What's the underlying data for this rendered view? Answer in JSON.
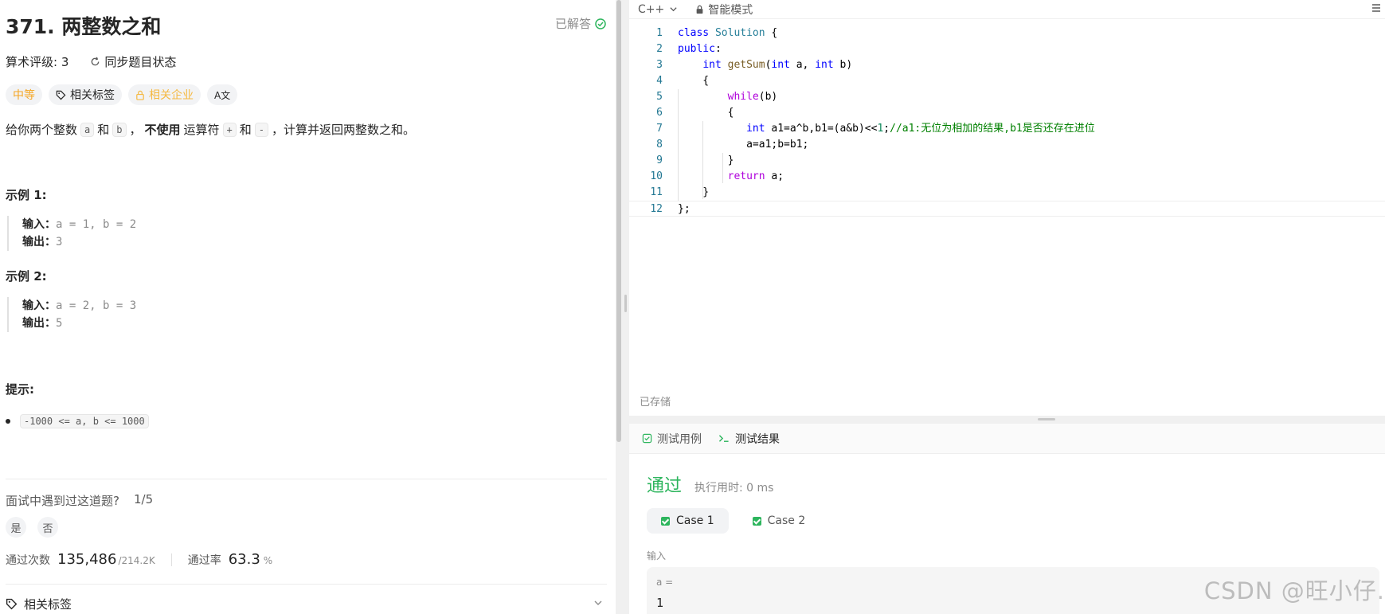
{
  "problem": {
    "title": "371. 两整数之和",
    "solved": "已解答",
    "rating": "算术评级: 3",
    "sync": "同步题目状态",
    "tags": {
      "difficulty": "中等",
      "related": "相关标签",
      "companies": "相关企业",
      "translate": "A文"
    },
    "desc": {
      "p1": "给你两个整数",
      "a": "a",
      "and1": "和",
      "b": "b",
      "p2": "，",
      "bold": "不使用",
      "p3": "运算符",
      "plus": "+",
      "and2": "和",
      "minus": "-",
      "p4": "，计算并返回两整数之和。"
    },
    "ex1": {
      "title": "示例 1:",
      "in_label": "输入：",
      "in": "a = 1, b = 2",
      "out_label": "输出：",
      "out": "3"
    },
    "ex2": {
      "title": "示例 2:",
      "in_label": "输入：",
      "in": "a = 2, b = 3",
      "out_label": "输出：",
      "out": "5"
    },
    "hint_title": "提示:",
    "hint": "-1000 <= a, b <= 1000",
    "interview": {
      "q": "面试中遇到过这道题?",
      "count": "1/5",
      "yes": "是",
      "no": "否"
    },
    "stats": {
      "accept_label": "通过次数",
      "accept": "135,486",
      "total": "/214.2K",
      "rate_label": "通过率",
      "rate": "63.3",
      "pct": "%"
    },
    "related_tags": "相关标签"
  },
  "editor": {
    "lang": "C++",
    "mode": "智能模式",
    "saved": "已存储",
    "line_numbers": [
      "1",
      "2",
      "3",
      "4",
      "5",
      "6",
      "7",
      "8",
      "9",
      "10",
      "11",
      "12"
    ]
  },
  "console": {
    "tab_cases": "测试用例",
    "tab_result": "测试结果",
    "status": "通过",
    "runtime": "执行用时: 0 ms",
    "case1": "Case 1",
    "case2": "Case 2",
    "input_label": "输入",
    "var": "a =",
    "value": "1"
  },
  "watermark": "CSDN @旺小仔."
}
